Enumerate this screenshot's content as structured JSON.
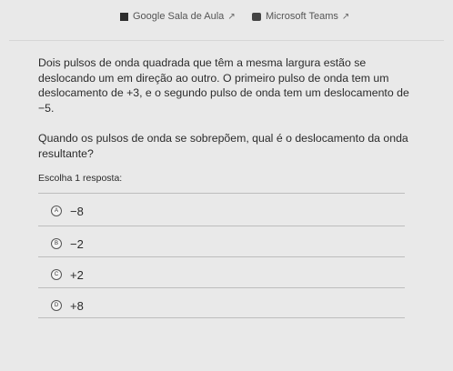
{
  "header": {
    "google_classroom": "Google Sala de Aula",
    "teams": "Microsoft Teams",
    "external_icon": "external-link-icon"
  },
  "question": {
    "text": "Dois pulsos de onda quadrada que têm a mesma largura estão se deslocando um em direção ao outro. O primeiro pulso de onda tem um deslocamento de +3, e o segundo pulso de onda tem um deslocamento de −5.",
    "prompt": "Quando os pulsos de onda se sobrepõem, qual é o deslocamento da onda resultante?"
  },
  "answer": {
    "instruction": "Escolha 1 resposta:",
    "options": [
      {
        "letter": "A",
        "value": "−8"
      },
      {
        "letter": "B",
        "value": "−2"
      },
      {
        "letter": "C",
        "value": "+2"
      },
      {
        "letter": "D",
        "value": "+8"
      }
    ]
  }
}
